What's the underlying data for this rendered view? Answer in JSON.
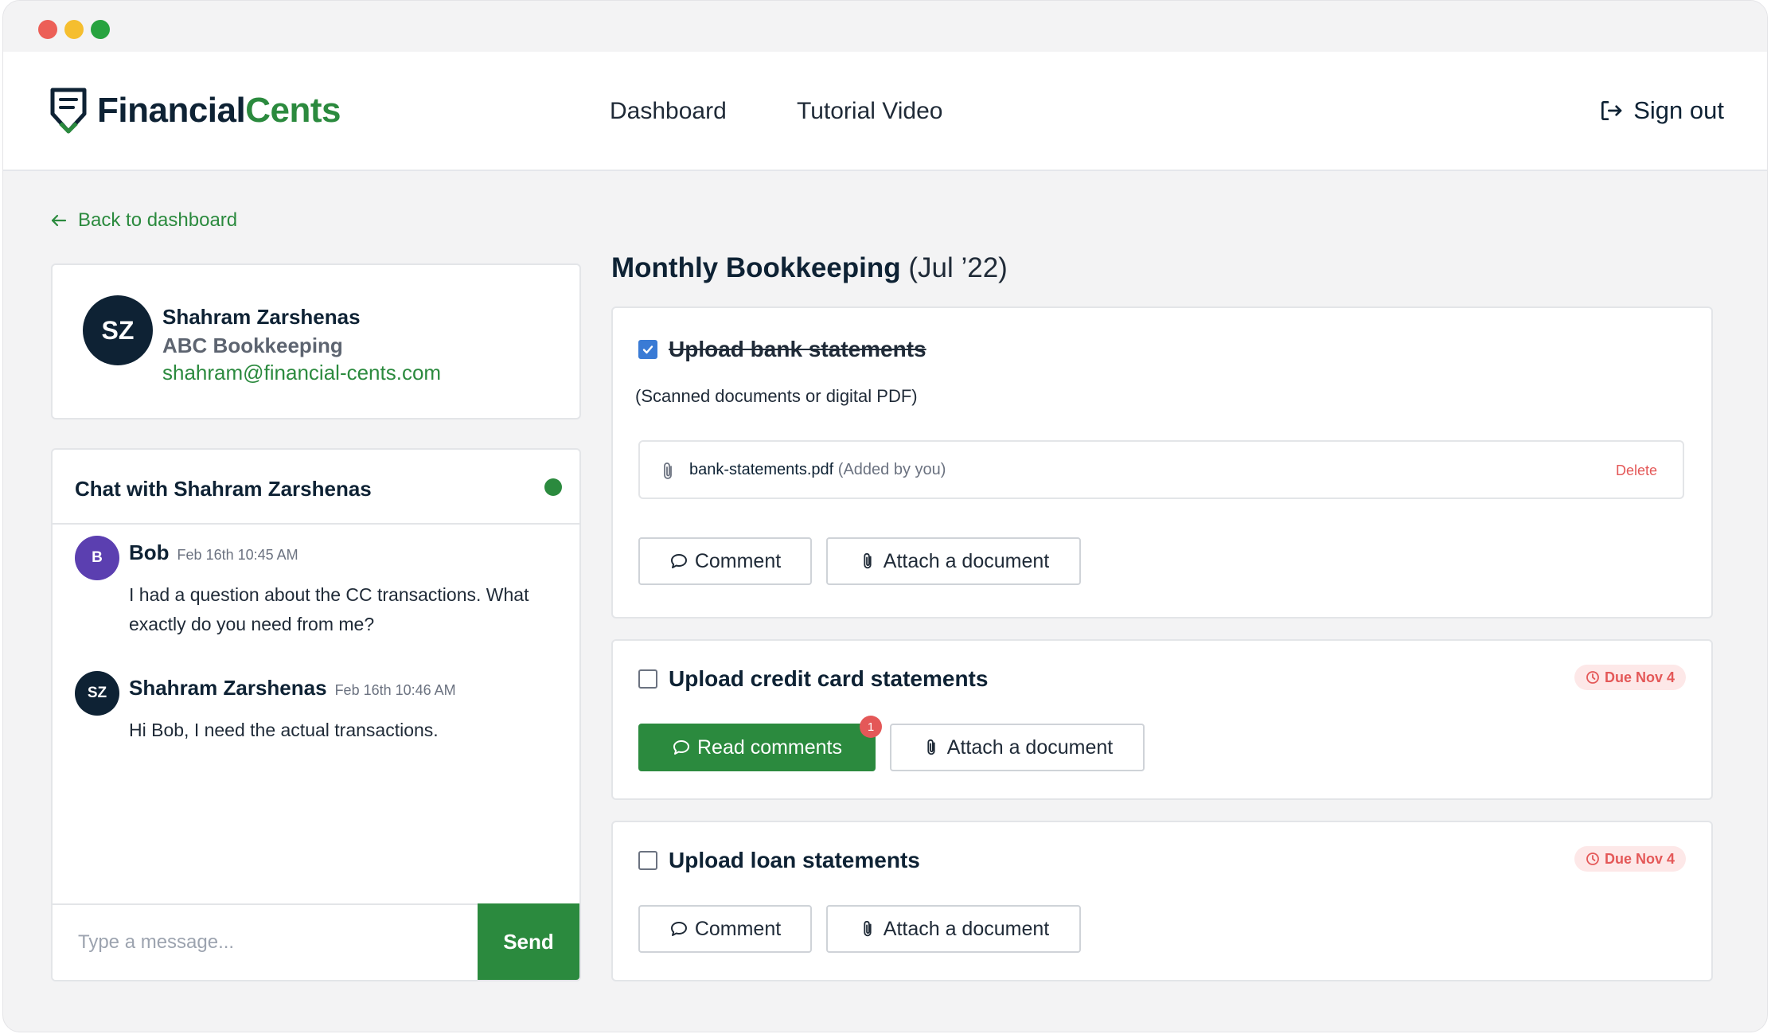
{
  "app": {
    "logo_part1": "Financial",
    "logo_part2": "Cents",
    "colors": {
      "brand_green": "#2b8a3e",
      "navy": "#0e2234",
      "alert_red": "#e45858",
      "check_blue": "#3a7bd5"
    }
  },
  "nav": {
    "dashboard": "Dashboard",
    "tutorial": "Tutorial Video",
    "signout": "Sign out"
  },
  "back_link": "Back to dashboard",
  "profile": {
    "initials": "SZ",
    "name": "Shahram Zarshenas",
    "company": "ABC Bookkeeping",
    "email": "shahram@financial-cents.com"
  },
  "chat": {
    "title": "Chat with Shahram Zarshenas",
    "messages": [
      {
        "initials": "B",
        "author": "Bob",
        "time": "Feb 16th 10:45 AM",
        "text": "I had a question about the CC transactions. What exactly do you need from me?",
        "avatar_color": "#5b3fb0"
      },
      {
        "initials": "SZ",
        "author": "Shahram Zarshenas",
        "time": "Feb 16th 10:46 AM",
        "text": "Hi Bob, I need the actual transactions.",
        "avatar_color": "#0e2234"
      }
    ],
    "input_placeholder": "Type a message...",
    "send_label": "Send"
  },
  "main": {
    "title": "Monthly Bookkeeping",
    "period": "(Jul ’22)",
    "tasks": [
      {
        "title": "Upload bank statements",
        "checked": true,
        "subtitle": "(Scanned documents or digital PDF)",
        "file_name": "bank-statements.pdf",
        "file_note": "(Added by you)",
        "file_action": "Delete",
        "comment_label": "Comment",
        "attach_label": "Attach a document"
      },
      {
        "title": "Upload credit card statements",
        "checked": false,
        "due": "Due Nov 4",
        "comment_label": "Read comments",
        "comment_count": "1",
        "attach_label": "Attach a document"
      },
      {
        "title": "Upload loan statements",
        "checked": false,
        "due": "Due Nov 4",
        "comment_label": "Comment",
        "attach_label": "Attach a document"
      }
    ]
  },
  "icons": [
    "logo-shield-icon",
    "sign-out-icon",
    "arrow-left-icon",
    "checkmark-icon",
    "paperclip-icon",
    "comment-bubble-icon",
    "clock-icon"
  ]
}
